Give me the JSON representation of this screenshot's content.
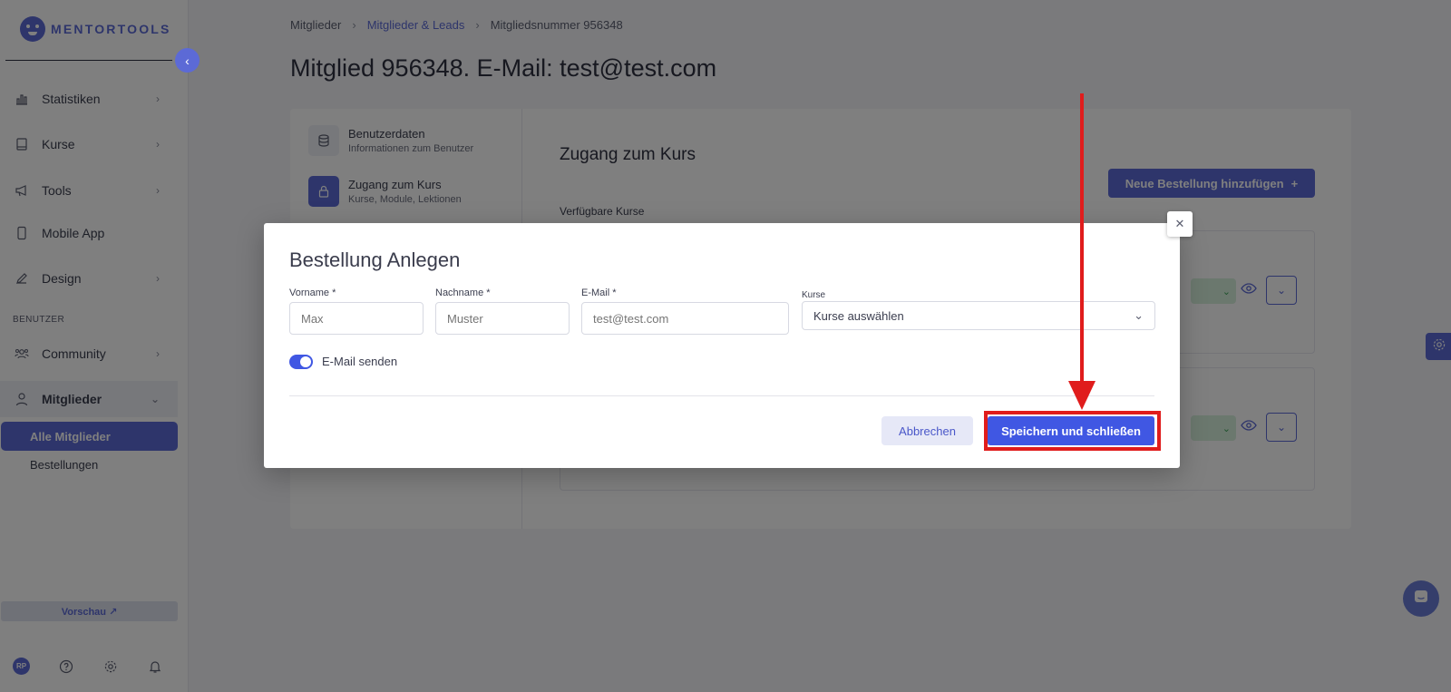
{
  "app": {
    "logo_text": "MENTORTOOLS",
    "accent_color": "#5c6ad6"
  },
  "sidebar": {
    "items": [
      {
        "label": "Statistiken",
        "icon": "bar-chart-icon"
      },
      {
        "label": "Kurse",
        "icon": "book-icon"
      },
      {
        "label": "Tools",
        "icon": "megaphone-icon"
      },
      {
        "label": "Mobile App",
        "icon": "phone-icon"
      },
      {
        "label": "Design",
        "icon": "pencil-icon"
      }
    ],
    "section_label": "BENUTZER",
    "community_label": "Community",
    "mitglieder_label": "Mitglieder",
    "sub_items": [
      "Alle Mitglieder",
      "Bestellungen"
    ],
    "preview_label": "Vorschau ↗",
    "avatar_initials": "RP"
  },
  "breadcrumb": {
    "items": [
      "Mitglieder",
      "Mitglieder & Leads",
      "Mitgliedsnummer 956348"
    ]
  },
  "page": {
    "title": "Mitglied 956348. E-Mail: test@test.com"
  },
  "card": {
    "tabs": [
      {
        "title": "Benutzerdaten",
        "subtitle": "Informationen zum Benutzer"
      },
      {
        "title": "Zugang zum Kurs",
        "subtitle": "Kurse, Module, Lektionen"
      }
    ],
    "section_title": "Zugang zum Kurs",
    "new_order_label": "Neue Bestellung hinzufügen",
    "available_courses_label": "Verfügbare Kurse"
  },
  "modal": {
    "title": "Bestellung Anlegen",
    "fields": {
      "first_name": {
        "label": "Vorname",
        "placeholder": "Max",
        "value": ""
      },
      "last_name": {
        "label": "Nachname",
        "placeholder": "Muster",
        "value": ""
      },
      "email": {
        "label": "E-Mail",
        "placeholder": "test@test.com",
        "value": ""
      },
      "courses": {
        "label": "Kurse",
        "selected": "Kurse auswählen"
      }
    },
    "required_marker": "*",
    "send_email_label": "E-Mail senden",
    "send_email_on": true,
    "cancel_label": "Abbrechen",
    "save_label": "Speichern und schließen"
  },
  "annotation": {
    "highlight_color": "#e01c1c"
  }
}
